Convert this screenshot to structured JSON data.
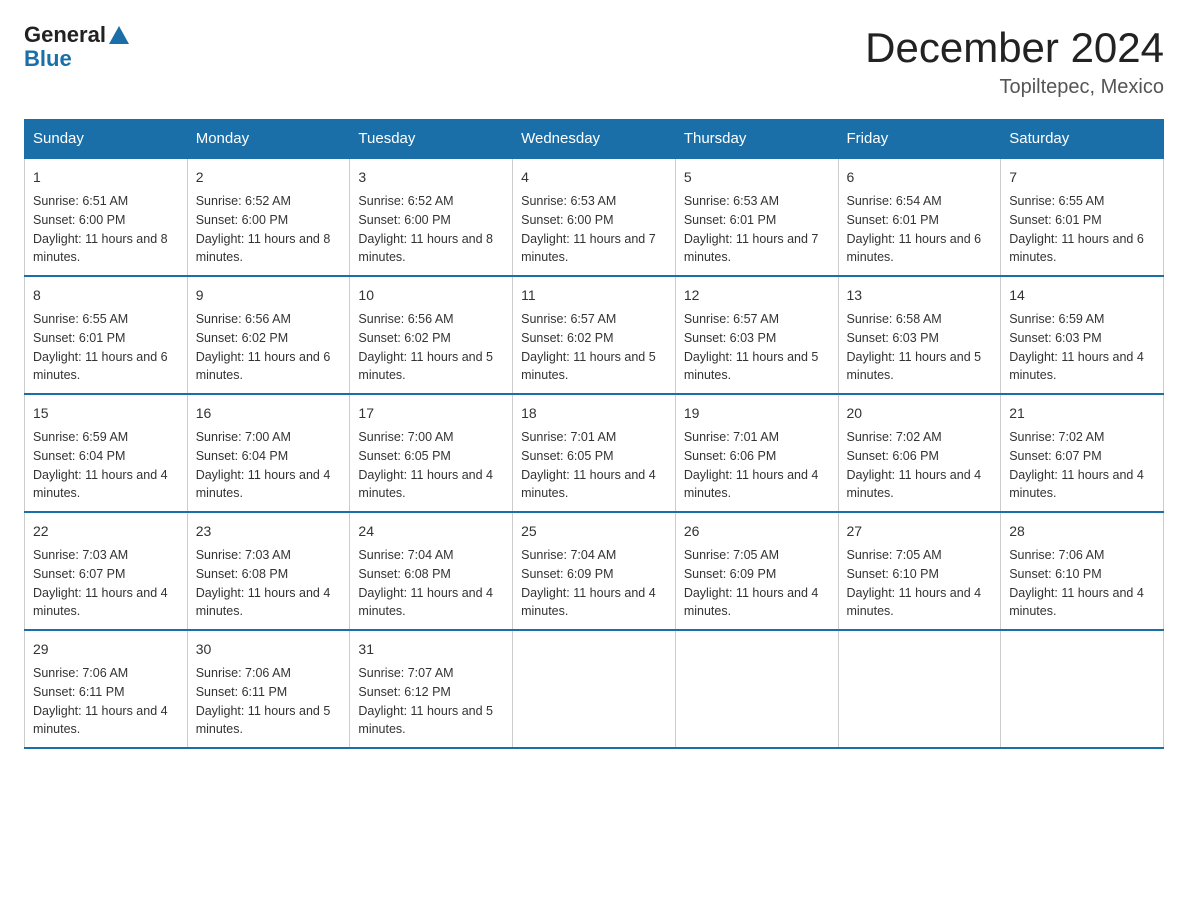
{
  "logo": {
    "general": "General",
    "blue": "Blue"
  },
  "title": "December 2024",
  "location": "Topiltepec, Mexico",
  "days_of_week": [
    "Sunday",
    "Monday",
    "Tuesday",
    "Wednesday",
    "Thursday",
    "Friday",
    "Saturday"
  ],
  "weeks": [
    [
      {
        "day": "1",
        "sunrise": "6:51 AM",
        "sunset": "6:00 PM",
        "daylight": "11 hours and 8 minutes."
      },
      {
        "day": "2",
        "sunrise": "6:52 AM",
        "sunset": "6:00 PM",
        "daylight": "11 hours and 8 minutes."
      },
      {
        "day": "3",
        "sunrise": "6:52 AM",
        "sunset": "6:00 PM",
        "daylight": "11 hours and 8 minutes."
      },
      {
        "day": "4",
        "sunrise": "6:53 AM",
        "sunset": "6:00 PM",
        "daylight": "11 hours and 7 minutes."
      },
      {
        "day": "5",
        "sunrise": "6:53 AM",
        "sunset": "6:01 PM",
        "daylight": "11 hours and 7 minutes."
      },
      {
        "day": "6",
        "sunrise": "6:54 AM",
        "sunset": "6:01 PM",
        "daylight": "11 hours and 6 minutes."
      },
      {
        "day": "7",
        "sunrise": "6:55 AM",
        "sunset": "6:01 PM",
        "daylight": "11 hours and 6 minutes."
      }
    ],
    [
      {
        "day": "8",
        "sunrise": "6:55 AM",
        "sunset": "6:01 PM",
        "daylight": "11 hours and 6 minutes."
      },
      {
        "day": "9",
        "sunrise": "6:56 AM",
        "sunset": "6:02 PM",
        "daylight": "11 hours and 6 minutes."
      },
      {
        "day": "10",
        "sunrise": "6:56 AM",
        "sunset": "6:02 PM",
        "daylight": "11 hours and 5 minutes."
      },
      {
        "day": "11",
        "sunrise": "6:57 AM",
        "sunset": "6:02 PM",
        "daylight": "11 hours and 5 minutes."
      },
      {
        "day": "12",
        "sunrise": "6:57 AM",
        "sunset": "6:03 PM",
        "daylight": "11 hours and 5 minutes."
      },
      {
        "day": "13",
        "sunrise": "6:58 AM",
        "sunset": "6:03 PM",
        "daylight": "11 hours and 5 minutes."
      },
      {
        "day": "14",
        "sunrise": "6:59 AM",
        "sunset": "6:03 PM",
        "daylight": "11 hours and 4 minutes."
      }
    ],
    [
      {
        "day": "15",
        "sunrise": "6:59 AM",
        "sunset": "6:04 PM",
        "daylight": "11 hours and 4 minutes."
      },
      {
        "day": "16",
        "sunrise": "7:00 AM",
        "sunset": "6:04 PM",
        "daylight": "11 hours and 4 minutes."
      },
      {
        "day": "17",
        "sunrise": "7:00 AM",
        "sunset": "6:05 PM",
        "daylight": "11 hours and 4 minutes."
      },
      {
        "day": "18",
        "sunrise": "7:01 AM",
        "sunset": "6:05 PM",
        "daylight": "11 hours and 4 minutes."
      },
      {
        "day": "19",
        "sunrise": "7:01 AM",
        "sunset": "6:06 PM",
        "daylight": "11 hours and 4 minutes."
      },
      {
        "day": "20",
        "sunrise": "7:02 AM",
        "sunset": "6:06 PM",
        "daylight": "11 hours and 4 minutes."
      },
      {
        "day": "21",
        "sunrise": "7:02 AM",
        "sunset": "6:07 PM",
        "daylight": "11 hours and 4 minutes."
      }
    ],
    [
      {
        "day": "22",
        "sunrise": "7:03 AM",
        "sunset": "6:07 PM",
        "daylight": "11 hours and 4 minutes."
      },
      {
        "day": "23",
        "sunrise": "7:03 AM",
        "sunset": "6:08 PM",
        "daylight": "11 hours and 4 minutes."
      },
      {
        "day": "24",
        "sunrise": "7:04 AM",
        "sunset": "6:08 PM",
        "daylight": "11 hours and 4 minutes."
      },
      {
        "day": "25",
        "sunrise": "7:04 AM",
        "sunset": "6:09 PM",
        "daylight": "11 hours and 4 minutes."
      },
      {
        "day": "26",
        "sunrise": "7:05 AM",
        "sunset": "6:09 PM",
        "daylight": "11 hours and 4 minutes."
      },
      {
        "day": "27",
        "sunrise": "7:05 AM",
        "sunset": "6:10 PM",
        "daylight": "11 hours and 4 minutes."
      },
      {
        "day": "28",
        "sunrise": "7:06 AM",
        "sunset": "6:10 PM",
        "daylight": "11 hours and 4 minutes."
      }
    ],
    [
      {
        "day": "29",
        "sunrise": "7:06 AM",
        "sunset": "6:11 PM",
        "daylight": "11 hours and 4 minutes."
      },
      {
        "day": "30",
        "sunrise": "7:06 AM",
        "sunset": "6:11 PM",
        "daylight": "11 hours and 5 minutes."
      },
      {
        "day": "31",
        "sunrise": "7:07 AM",
        "sunset": "6:12 PM",
        "daylight": "11 hours and 5 minutes."
      },
      null,
      null,
      null,
      null
    ]
  ]
}
